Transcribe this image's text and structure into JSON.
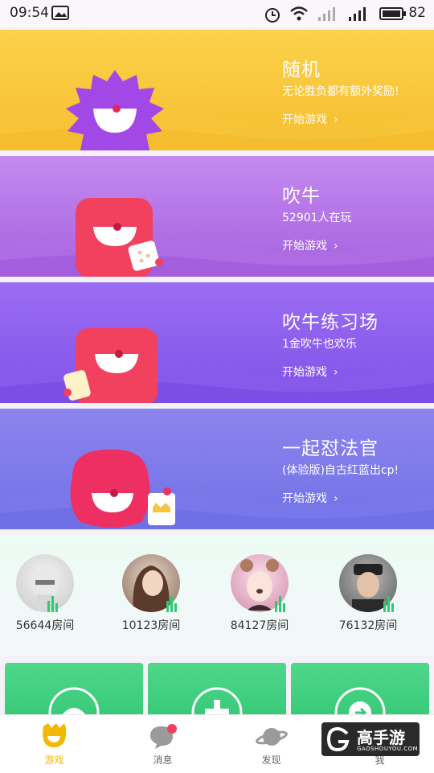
{
  "status_bar": {
    "time": "09:54",
    "battery": "82"
  },
  "cards": [
    {
      "title": "随机",
      "subtitle": "无论胜负都有额外奖励!",
      "start_label": "开始游戏"
    },
    {
      "title": "吹牛",
      "subtitle": "52901人在玩",
      "start_label": "开始游戏"
    },
    {
      "title": "吹牛练习场",
      "subtitle": "1金吹牛也欢乐",
      "start_label": "开始游戏"
    },
    {
      "title": "一起怼法官",
      "subtitle": "(体验版)自古红蓝出cp!",
      "start_label": "开始游戏"
    }
  ],
  "rooms": [
    {
      "count": "56644房间"
    },
    {
      "count": "10123房间"
    },
    {
      "count": "84127房间"
    },
    {
      "count": "76132房间"
    }
  ],
  "tabs": [
    {
      "label": "游戏",
      "active": true
    },
    {
      "label": "消息"
    },
    {
      "label": "发现"
    },
    {
      "label": "我"
    }
  ],
  "watermark": {
    "text": "高手游",
    "sub": "GAOSHOUYOU.COM"
  },
  "colors": {
    "card1": "#f8c53a",
    "card2": "#b06fe3",
    "card3": "#8d5ff0",
    "card4": "#7b78ea",
    "accent_yellow": "#f5b800",
    "mascot_red": "#f2405f"
  }
}
